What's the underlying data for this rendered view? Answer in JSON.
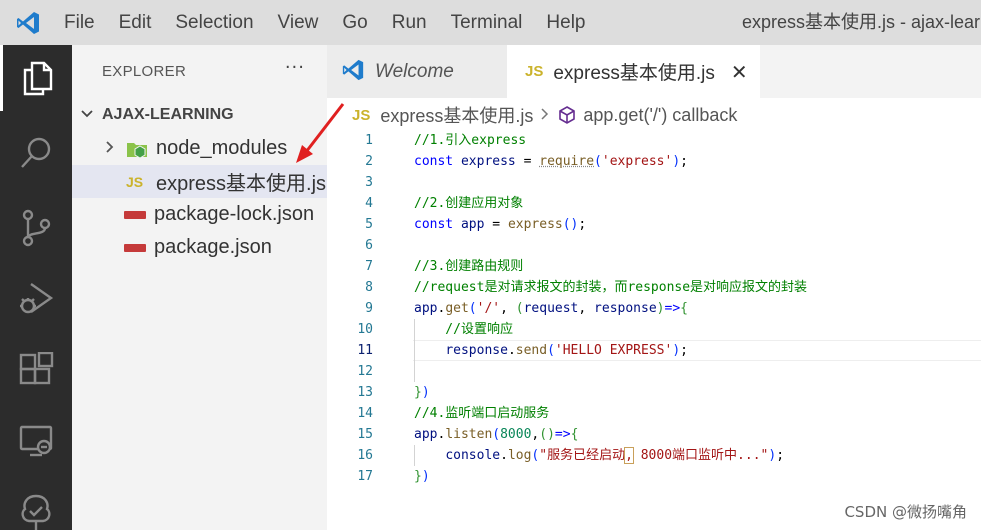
{
  "menu": [
    "File",
    "Edit",
    "Selection",
    "View",
    "Go",
    "Run",
    "Terminal",
    "Help"
  ],
  "window_title": "express基本使用.js - ajax-learn",
  "sidebar": {
    "header": "EXPLORER",
    "more": "···",
    "folder": "AJAX-LEARNING",
    "items": [
      {
        "label": "node_modules"
      },
      {
        "label": "express基本使用.js",
        "badge": "JS"
      },
      {
        "label": "package-lock.json",
        "badge": "npm"
      },
      {
        "label": "package.json",
        "badge": "npm"
      }
    ]
  },
  "tabs": [
    {
      "label": "Welcome"
    },
    {
      "label": "express基本使用.js",
      "badge": "JS",
      "close": "✕"
    }
  ],
  "breadcrumb": {
    "badge": "JS",
    "file": "express基本使用.js",
    "symbol": "app.get('/') callback"
  },
  "editor": {
    "current_line": 11,
    "lines": [
      {
        "n": "1",
        "text": "//1.引入express"
      },
      {
        "n": "2",
        "text": "const express = require('express');"
      },
      {
        "n": "3",
        "text": ""
      },
      {
        "n": "4",
        "text": "//2.创建应用对象"
      },
      {
        "n": "5",
        "text": "const app = express();"
      },
      {
        "n": "6",
        "text": ""
      },
      {
        "n": "7",
        "text": "//3.创建路由规则"
      },
      {
        "n": "8",
        "text": "//request是对请求报文的封装，而response是对响应报文的封装"
      },
      {
        "n": "9",
        "text": "app.get('/', (request, response)=>{"
      },
      {
        "n": "10",
        "text": "    //设置响应"
      },
      {
        "n": "11",
        "text": "    response.send('HELLO EXPRESS');"
      },
      {
        "n": "12",
        "text": ""
      },
      {
        "n": "13",
        "text": "})"
      },
      {
        "n": "14",
        "text": "//4.监听端口启动服务"
      },
      {
        "n": "15",
        "text": "app.listen(8000,()=>{"
      },
      {
        "n": "16",
        "text": "    console.log(\"服务已经启动, 8000端口监听中...\");"
      },
      {
        "n": "17",
        "text": "})"
      }
    ]
  },
  "watermark": "CSDN @微扬嘴角",
  "colors": {
    "activity_bar": "#2c2c2c",
    "sidebar": "#f3f3f3",
    "title_bar": "#dddddd",
    "selection": "#e4e6f1",
    "annotation_arrow": "#e02020"
  }
}
